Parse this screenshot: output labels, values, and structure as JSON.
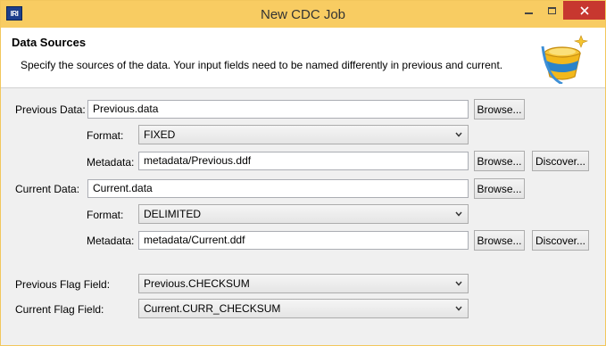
{
  "window": {
    "title": "New CDC Job",
    "app_icon_text": "IRI"
  },
  "header": {
    "title": "Data Sources",
    "description": "Specify the sources of the data. Your input fields need to be named differently in previous and current."
  },
  "previous": {
    "data_label": "Previous Data:",
    "data_value": "Previous.data",
    "format_label": "Format:",
    "format_value": "FIXED",
    "metadata_label": "Metadata:",
    "metadata_value": "metadata/Previous.ddf"
  },
  "current": {
    "data_label": "Current Data:",
    "data_value": "Current.data",
    "format_label": "Format:",
    "format_value": "DELIMITED",
    "metadata_label": "Metadata:",
    "metadata_value": "metadata/Current.ddf"
  },
  "flags": {
    "previous_label": "Previous Flag Field:",
    "previous_value": "Previous.CHECKSUM",
    "current_label": "Current Flag Field:",
    "current_value": "Current.CURR_CHECKSUM"
  },
  "buttons": {
    "browse": "Browse...",
    "discover": "Discover..."
  },
  "icons": {
    "app": "iri-logo-icon",
    "header": "bucket-icon",
    "dropdown": "chevron-down-icon"
  }
}
